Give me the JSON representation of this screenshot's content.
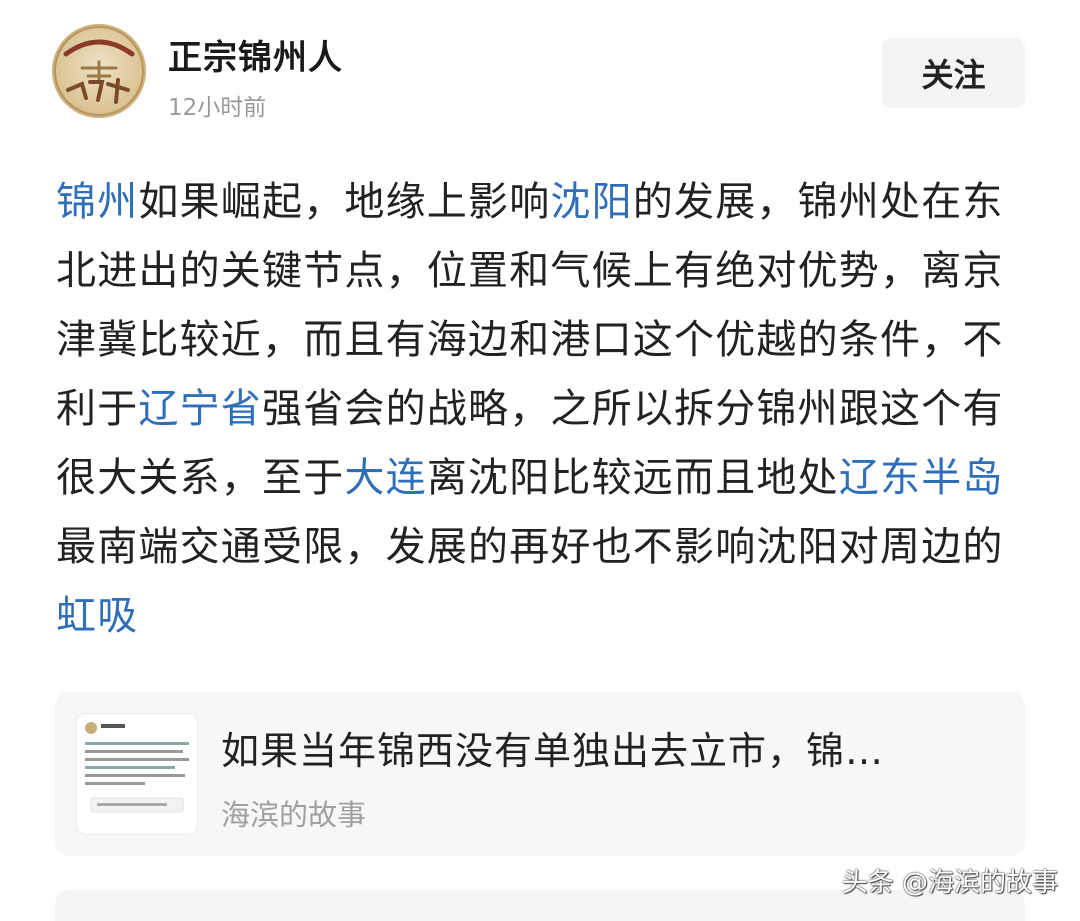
{
  "header": {
    "author_name": "正宗锦州人",
    "time": "12小时前",
    "follow_label": "关注",
    "avatar_logo_text": "头条达人 正宗 锦州人"
  },
  "post": {
    "segments": [
      {
        "text": "锦州",
        "link": true
      },
      {
        "text": "如果崛起，地缘上影响",
        "link": false
      },
      {
        "text": "沈阳",
        "link": true
      },
      {
        "text": "的发展，锦州处在东北进出的关键节点，位置和气候上有绝对优势，离京津冀比较近，而且有海边和港口这个优越的条件，不利于",
        "link": false
      },
      {
        "text": "辽宁省",
        "link": true
      },
      {
        "text": "强省会的战略，之所以拆分锦州跟这个有很大关系，至于",
        "link": false
      },
      {
        "text": "大连",
        "link": true
      },
      {
        "text": "离沈阳比较远而且地处",
        "link": false
      },
      {
        "text": "辽东半岛",
        "link": true
      },
      {
        "text": "最南端交通受限，发展的再好也不影响沈阳对周边的",
        "link": false
      },
      {
        "text": "虹吸",
        "link": true
      }
    ],
    "link_color": "#2f6fba"
  },
  "quote": {
    "title": "如果当年锦西没有单独出去立市，锦…",
    "source": "海滨的故事"
  },
  "watermark": "头条 @海滨的故事"
}
